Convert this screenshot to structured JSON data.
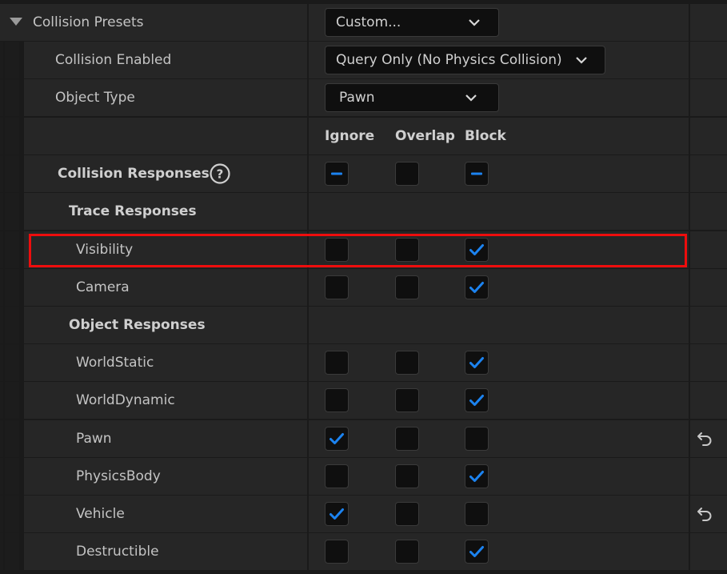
{
  "collision_presets": {
    "label": "Collision Presets",
    "value": "Custom..."
  },
  "collision_enabled": {
    "label": "Collision Enabled",
    "value": "Query Only (No Physics Collision)"
  },
  "object_type": {
    "label": "Object Type",
    "value": "Pawn"
  },
  "columns": {
    "ignore": "Ignore",
    "overlap": "Overlap",
    "block": "Block"
  },
  "collision_responses": {
    "label": "Collision Responses",
    "help_glyph": "?",
    "ignore": "mixed",
    "overlap": "unchecked",
    "block": "mixed"
  },
  "trace_responses_label": "Trace Responses",
  "object_responses_label": "Object Responses",
  "channels": [
    {
      "name": "Visibility",
      "ignore": false,
      "overlap": false,
      "block": true,
      "has_reset": false
    },
    {
      "name": "Camera",
      "ignore": false,
      "overlap": false,
      "block": true,
      "has_reset": false
    },
    {
      "name": "WorldStatic",
      "ignore": false,
      "overlap": false,
      "block": true,
      "has_reset": false
    },
    {
      "name": "WorldDynamic",
      "ignore": false,
      "overlap": false,
      "block": true,
      "has_reset": false
    },
    {
      "name": "Pawn",
      "ignore": true,
      "overlap": false,
      "block": false,
      "has_reset": true
    },
    {
      "name": "PhysicsBody",
      "ignore": false,
      "overlap": false,
      "block": true,
      "has_reset": false
    },
    {
      "name": "Vehicle",
      "ignore": true,
      "overlap": false,
      "block": false,
      "has_reset": true
    },
    {
      "name": "Destructible",
      "ignore": false,
      "overlap": false,
      "block": true,
      "has_reset": false
    }
  ],
  "colors": {
    "check": "#1c83f0",
    "highlight": "#ee0d0d"
  },
  "icons": {
    "expander": "triangle-down-icon",
    "dropdown": "chevron-down-icon",
    "reset": "undo-arrow-icon",
    "help": "question-circle-icon"
  }
}
